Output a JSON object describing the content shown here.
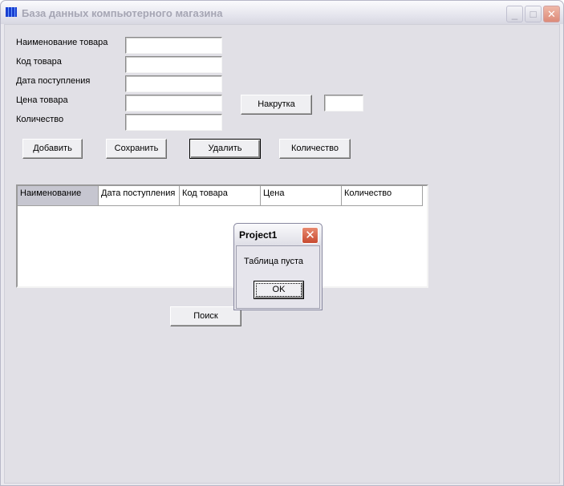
{
  "window": {
    "title": "База данных компьютерного магазина",
    "buttons": {
      "minimize": "_",
      "maximize": "□",
      "close": "✕"
    }
  },
  "form": {
    "labels": [
      "Наименование товара",
      "Код товара",
      "Дата поступления",
      "Цена товара",
      "Количество"
    ],
    "values": [
      "",
      "",
      "",
      "",
      ""
    ],
    "markup_button": "Накрутка",
    "markup_value": ""
  },
  "actions": {
    "add": "Добавить",
    "save": "Сохранить",
    "delete": "Удалить",
    "count": "Количество",
    "search": "Поиск"
  },
  "grid": {
    "columns": [
      "Наименование",
      "Дата поступления",
      "Код товара",
      "Цена",
      "Количество"
    ]
  },
  "dialog": {
    "title": "Project1",
    "message": "Таблица пуста",
    "ok": "OK",
    "close": "✕"
  }
}
